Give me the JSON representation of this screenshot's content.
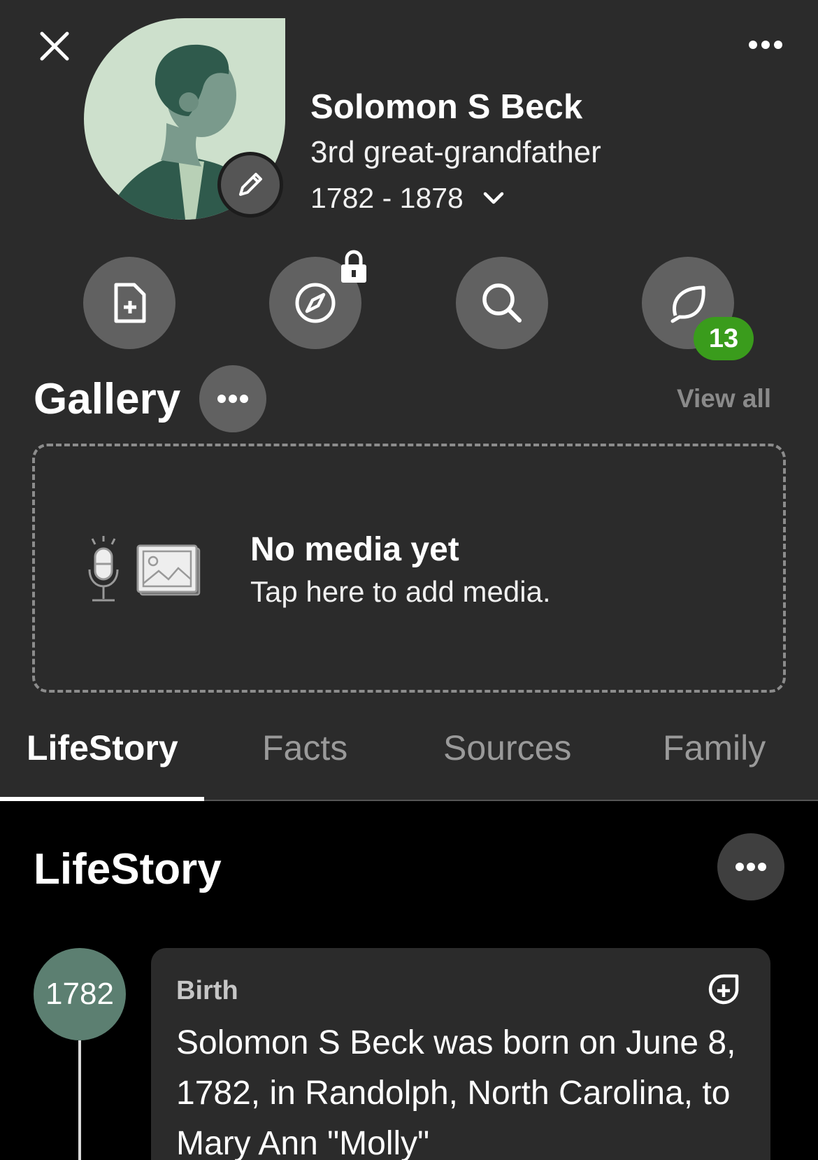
{
  "profile": {
    "name": "Solomon S Beck",
    "relation": "3rd great-grandfather",
    "lifespan": "1782 - 1878"
  },
  "actions": {
    "items": [
      {
        "icon": "add-document-icon"
      },
      {
        "icon": "compass-icon",
        "locked": true
      },
      {
        "icon": "search-icon"
      },
      {
        "icon": "leaf-hint-icon",
        "badge": "13"
      }
    ]
  },
  "gallery": {
    "title": "Gallery",
    "view_all": "View all",
    "empty_title": "No media yet",
    "empty_subtitle": "Tap here to add media."
  },
  "tabs": [
    {
      "label": "LifeStory",
      "active": true
    },
    {
      "label": "Facts"
    },
    {
      "label": "Sources"
    },
    {
      "label": "Family"
    }
  ],
  "lifestory": {
    "title": "LifeStory",
    "events": [
      {
        "year": "1782",
        "type": "Birth",
        "text": "Solomon S Beck was born on June 8, 1782, in Randolph, North Carolina, to Mary Ann \"Molly\""
      }
    ]
  },
  "colors": {
    "background": "#000000",
    "header_background": "#2b2b2b",
    "badge": "#3a9c1c",
    "year_circle": "#5c7f71"
  }
}
